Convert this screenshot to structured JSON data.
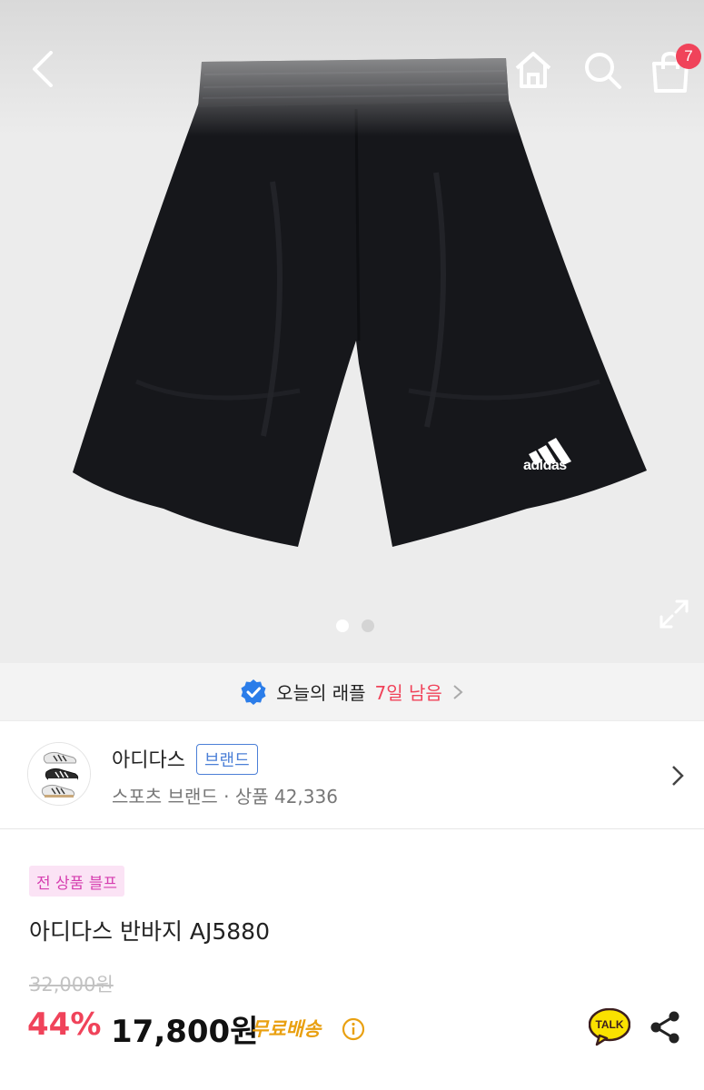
{
  "header": {
    "cart_count": "7"
  },
  "hero": {
    "brand_mark": "adidas",
    "slide_count": 2,
    "active_slide": 1
  },
  "raffle": {
    "label": "오늘의 래플",
    "days_left": "7일 남음"
  },
  "brand": {
    "name": "아디다스",
    "tag": "브랜드",
    "subtitle": "스포츠 브랜드 · 상품 42,336"
  },
  "product": {
    "promo_badge": "전 상품 블프",
    "title": "아디다스 반바지 AJ5880",
    "original_price": "32,000원",
    "discount": "44%",
    "price": "17,800원",
    "shipping": "무료배송",
    "talk_label": "TALK"
  },
  "colors": {
    "accent_red": "#f0435a",
    "brand_blue": "#4b7fd7",
    "promo_pink": "#d63fb0",
    "shipping_orange": "#e9a010",
    "kakao_yellow": "#fae100"
  },
  "icons": [
    "back-icon",
    "home-icon",
    "search-icon",
    "cart-icon",
    "expand-icon",
    "verified-icon",
    "chevron-right-icon",
    "info-icon",
    "kakao-talk-icon",
    "share-icon"
  ]
}
